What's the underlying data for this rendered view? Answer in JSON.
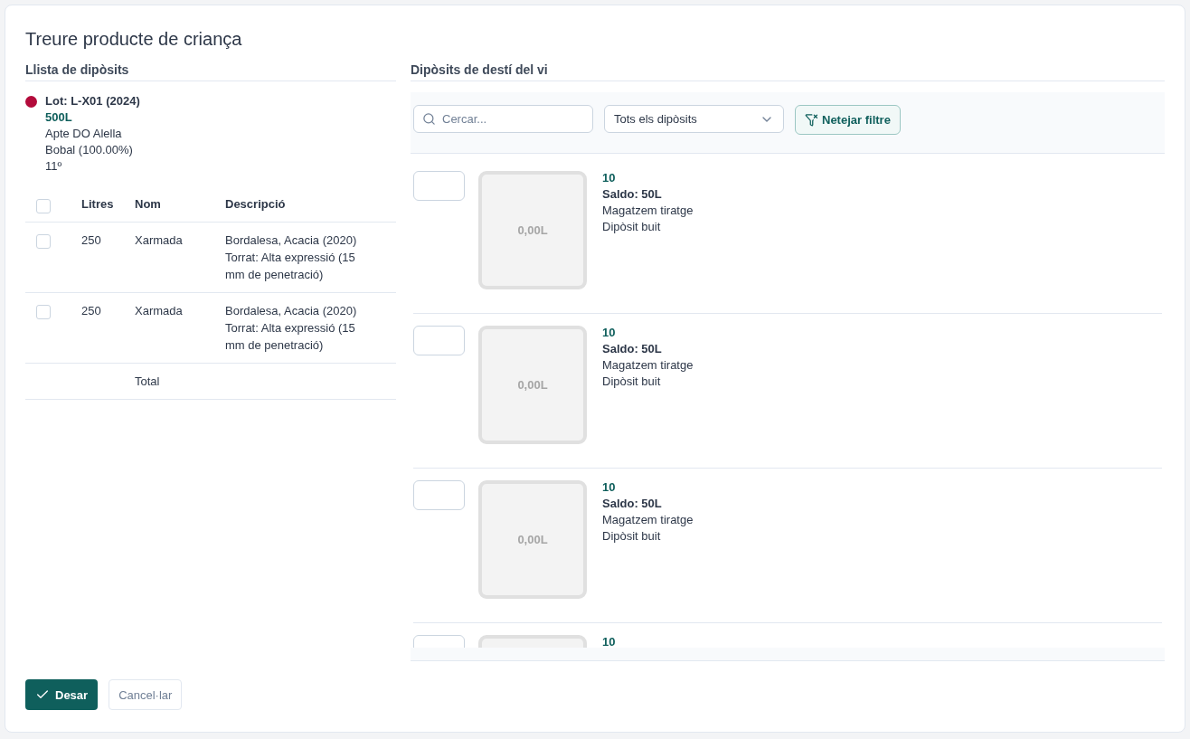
{
  "title": "Treure producte de criança",
  "left": {
    "heading": "Llista de dipòsits",
    "lot": {
      "color": "#b30b3b",
      "name": "Lot: L-X01 (2024)",
      "volume": "500L",
      "lines": [
        "Apte DO Alella",
        "Bobal (100.00%)",
        "11º"
      ]
    },
    "table": {
      "header_checked": false,
      "columns": [
        "Litres",
        "Nom",
        "Descripció"
      ],
      "rows": [
        {
          "checked": false,
          "litres": "250",
          "nom": "Xarmada",
          "descripcio": "Bordalesa, Acacia (2020) Torrat: Alta expressió (15 mm de penetració)"
        },
        {
          "checked": false,
          "litres": "250",
          "nom": "Xarmada",
          "descripcio": "Bordalesa, Acacia (2020) Torrat: Alta expressió (15 mm de penetració)"
        }
      ],
      "total_label": "Total"
    }
  },
  "right": {
    "heading": "Dipòsits de destí del vi",
    "search": {
      "placeholder": "Cercar..."
    },
    "filter": {
      "value": "Tots els dipòsits"
    },
    "clear_button": "Netejar filtre",
    "tanks": [
      {
        "fill": "0,00L",
        "number": "10",
        "saldo": "Saldo: 50L",
        "location": "Magatzem tiratge",
        "status": "Dipòsit buit"
      },
      {
        "fill": "0,00L",
        "number": "10",
        "saldo": "Saldo: 50L",
        "location": "Magatzem tiratge",
        "status": "Dipòsit buit"
      },
      {
        "fill": "0,00L",
        "number": "10",
        "saldo": "Saldo: 50L",
        "location": "Magatzem tiratge",
        "status": "Dipòsit buit"
      },
      {
        "number": "10"
      }
    ]
  },
  "buttons": {
    "save": "Desar",
    "cancel": "Cancel·lar"
  }
}
